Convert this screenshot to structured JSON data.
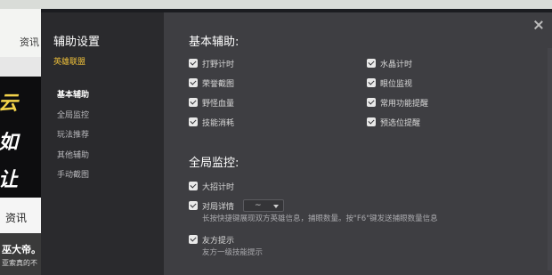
{
  "background": {
    "nav_text": "资讯",
    "banner_lines": [
      "云",
      "如",
      "让"
    ],
    "section_text": "资讯",
    "thumb_title": "巫大帝。",
    "thumb_sub": "亚索真的不"
  },
  "dialog": {
    "title": "辅助设置",
    "game": "英雄联盟",
    "menu": [
      {
        "label": "基本辅助",
        "active": true
      },
      {
        "label": "全局监控",
        "active": false
      },
      {
        "label": "玩法推荐",
        "active": false
      },
      {
        "label": "其他辅助",
        "active": false
      },
      {
        "label": "手动截图",
        "active": false
      }
    ],
    "basic": {
      "title": "基本辅助:",
      "options": [
        [
          "打野计时",
          "水晶计时"
        ],
        [
          "荣誉截图",
          "眼位监视"
        ],
        [
          "野怪血量",
          "常用功能提醒"
        ],
        [
          "技能消耗",
          "预选位提醒"
        ]
      ]
    },
    "monitor": {
      "title": "全局监控:",
      "ult_timer": "大招计时",
      "match_detail": "对局详情",
      "match_detail_select": "~",
      "match_detail_desc": "长按快捷键展现双方英雄信息，捕眼数量。按\"F6\"键发送捕眼数量信息",
      "ally_tip": "友方提示",
      "ally_tip_desc": "友方一级技能提示"
    }
  },
  "colors": {
    "accent": "#f0c13a",
    "sidebar_bg": "#2a2a2d",
    "panel_bg": "#3e3e42"
  }
}
